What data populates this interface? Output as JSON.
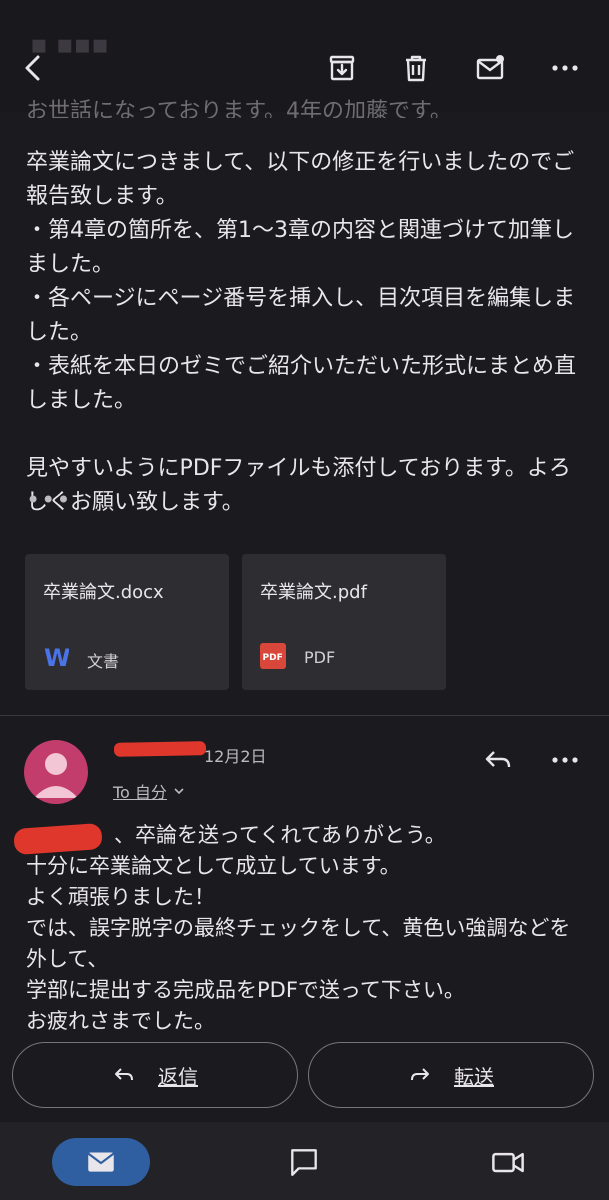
{
  "header": {
    "back_icon": "back-arrow-icon",
    "actions": [
      "archive-icon",
      "delete-icon",
      "mark-unread-icon",
      "more-icon"
    ]
  },
  "message1": {
    "cut_line": "お世話になっております。4年の加藤です。",
    "body": "卒業論文につきまして、以下の修正を行いましたのでご報告致します。\n・第4章の箇所を、第1〜3章の内容と関連づけて加筆しました。\n・各ページにページ番号を挿入し、目次項目を編集しました。\n・表紙を本日のゼミでご紹介いただいた形式にまとめ直しました。\n\n見やすいようにPDFファイルも添付しております。よろしくお願い致します。",
    "ellipsis": "•••",
    "attachments": [
      {
        "name": "卒業論文.docx",
        "type": "文書",
        "icon": "word-icon",
        "color": "#4a73e8"
      },
      {
        "name": "卒業論文.pdf",
        "type": "PDF",
        "icon": "pdf-icon",
        "color": "#d9473b"
      }
    ]
  },
  "message2": {
    "date": "12月2日",
    "to_label": "To 自分",
    "body": "、卒論を送ってくれてありがとう。\n十分に卒業論文として成立しています。\nよく頑張りました！\nでは、誤字脱字の最終チェックをして、黄色い強調などを外して、\n学部に提出する完成品をPDFで送って下さい。\nお疲れさまでした。",
    "avatar_color": "#c23d6b"
  },
  "actions": {
    "reply_label": "返信",
    "forward_label": "転送"
  },
  "bottom_nav": {
    "items": [
      "mail-icon",
      "chat-icon",
      "meet-icon"
    ],
    "active_color": "#2f5fa0"
  }
}
